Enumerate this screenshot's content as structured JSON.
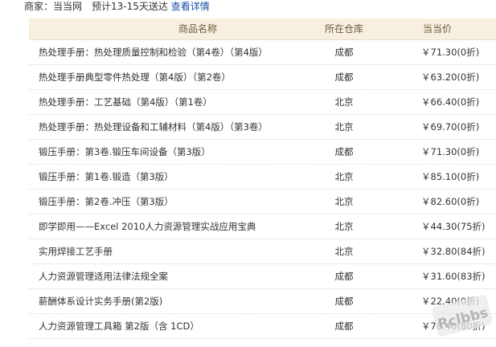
{
  "seller": {
    "label": "商家：当当网",
    "delivery": "预计13-15天送达",
    "details_link": "查看详情"
  },
  "table": {
    "headers": {
      "name": "商品名称",
      "warehouse": "所在仓库",
      "price": "当当价"
    },
    "rows": [
      {
        "name": "热处理手册：热处理质量控制和检验（第4卷）（第4版）",
        "warehouse": "成都",
        "price": "￥71.30(0折)"
      },
      {
        "name": "热处理手册典型零件热处理（第4版）（第2卷）",
        "warehouse": "成都",
        "price": "￥63.20(0折)"
      },
      {
        "name": "热处理手册：工艺基础（第4版）（第1卷）",
        "warehouse": "北京",
        "price": "￥66.40(0折)"
      },
      {
        "name": "热处理手册：热处理设备和工辅材料（第4版）（第3卷）",
        "warehouse": "北京",
        "price": "￥69.70(0折)"
      },
      {
        "name": "锻压手册：第3卷.锻压车间设备（第3版）",
        "warehouse": "成都",
        "price": "￥71.30(0折)"
      },
      {
        "name": "锻压手册：第1卷.锻造（第3版）",
        "warehouse": "北京",
        "price": "￥85.10(0折)"
      },
      {
        "name": "锻压手册：第2卷.冲压（第3版）",
        "warehouse": "北京",
        "price": "￥82.60(0折)"
      },
      {
        "name": "即学即用——Excel 2010人力资源管理实战应用宝典",
        "warehouse": "北京",
        "price": "￥44.30(75折)"
      },
      {
        "name": "实用焊接工艺手册",
        "warehouse": "北京",
        "price": "￥32.80(84折)"
      },
      {
        "name": "人力资源管理适用法律法规全案",
        "warehouse": "成都",
        "price": "￥31.60(83折)"
      },
      {
        "name": "薪酬体系设计实务手册(第2版)",
        "warehouse": "成都",
        "price": "￥22.40(0折)"
      },
      {
        "name": "人力资源管理工具箱 第2版（含 1CD）",
        "warehouse": "成都",
        "price": "￥78.40(80折)"
      }
    ]
  },
  "watermark": {
    "text": "Rclbbs"
  }
}
